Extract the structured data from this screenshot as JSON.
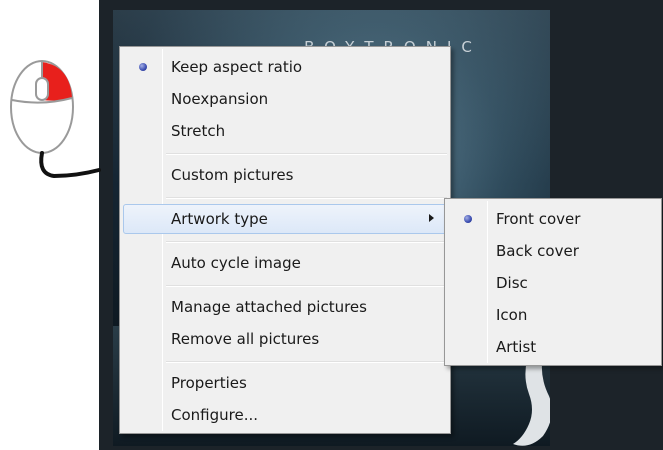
{
  "artwork": {
    "band_name": "BOYTRONIC"
  },
  "main_menu": {
    "items": [
      {
        "label": "Keep aspect ratio",
        "checked": true
      },
      {
        "label": "Noexpansion",
        "checked": false
      },
      {
        "label": "Stretch",
        "checked": false
      },
      {
        "label": "Custom pictures",
        "checked": false
      },
      {
        "label": "Artwork type",
        "has_submenu": true,
        "highlighted": true
      },
      {
        "label": "Auto cycle image",
        "checked": false
      },
      {
        "label": "Manage attached pictures"
      },
      {
        "label": "Remove all pictures"
      },
      {
        "label": "Properties"
      },
      {
        "label": "Configure..."
      }
    ]
  },
  "sub_menu": {
    "items": [
      {
        "label": "Front cover",
        "checked": true
      },
      {
        "label": "Back cover",
        "checked": false
      },
      {
        "label": "Disc",
        "checked": false
      },
      {
        "label": "Icon",
        "checked": false
      },
      {
        "label": "Artist",
        "checked": false
      }
    ]
  },
  "colors": {
    "menu_bg": "#f0f0f0",
    "highlight_border": "#aac8ec",
    "mouse_button_active": "#e8201c"
  }
}
